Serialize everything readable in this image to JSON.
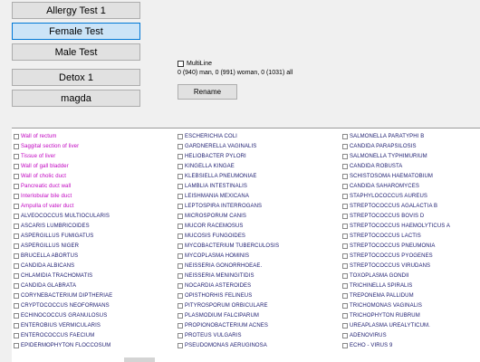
{
  "buttons": [
    "Allergy Test 1",
    "Female Test",
    "Male Test",
    "Detox 1",
    "magda"
  ],
  "selected_button": "Female Test",
  "multiline_label": "MultiLine",
  "counts_text": "0 (940) man, 0 (991) woman, 0 (1031) all",
  "rename_label": "Rename",
  "columns": [
    [
      {
        "label": "Wall of rectum",
        "style": "pink"
      },
      {
        "label": "Saggital section of liver",
        "style": "pink"
      },
      {
        "label": "Tissue of liver",
        "style": "pink"
      },
      {
        "label": "Wall of gall bladder",
        "style": "pink"
      },
      {
        "label": "Wall of cholic duct",
        "style": "pink"
      },
      {
        "label": "Pancreatic duct wall",
        "style": "pink"
      },
      {
        "label": "Interlobular bile duct",
        "style": "pink"
      },
      {
        "label": "Ampulla of vater duct",
        "style": "pink"
      },
      {
        "label": "ALVEOCOCCUS MULTIOCULARIS",
        "style": "normal"
      },
      {
        "label": "ASCARIS LUMBRICOIDES",
        "style": "normal"
      },
      {
        "label": "ASPERGILLUS FUMIGATUS",
        "style": "normal"
      },
      {
        "label": "ASPERGILLUS NIGER",
        "style": "normal"
      },
      {
        "label": "BRUCELLA ABORTUS",
        "style": "normal"
      },
      {
        "label": "CANDIDA ALBICANS",
        "style": "normal"
      },
      {
        "label": "CHLAMIDIA TRACHOMATIS",
        "style": "normal"
      },
      {
        "label": "CANDIDA GLABRATA",
        "style": "normal"
      },
      {
        "label": "CORYNEBACTERIUM DIPTHERIAE",
        "style": "normal"
      },
      {
        "label": "CRYPTOCOCCUS NEOFORMANS",
        "style": "normal"
      },
      {
        "label": "ECHINOCOCCUS GRANULOSUS",
        "style": "normal"
      },
      {
        "label": "ENTEROBIUS VERMICULARIS",
        "style": "normal"
      },
      {
        "label": "ENTEROCOCCUS FAECIUM",
        "style": "normal"
      },
      {
        "label": "EPIDERMOPHYTON FLOCCOSUM",
        "style": "normal"
      }
    ],
    [
      {
        "label": "ESCHERICHIA COLI",
        "style": "normal"
      },
      {
        "label": "GARDNERELLA VAGINALIS",
        "style": "normal"
      },
      {
        "label": "HELIOBACTER PYLORI",
        "style": "normal"
      },
      {
        "label": "KINGELLA KINGAE",
        "style": "normal"
      },
      {
        "label": "KLEBSIELLA PNEUMONIAE",
        "style": "normal"
      },
      {
        "label": "LAMBLIA INTESTINALIS",
        "style": "normal"
      },
      {
        "label": "LEISHMANIA MEXICANA",
        "style": "normal"
      },
      {
        "label": "LEPTOSPIRA INTERROGANS",
        "style": "normal"
      },
      {
        "label": "MICROSPORUM CANIS",
        "style": "normal"
      },
      {
        "label": "MUCOR RACEMOSUS",
        "style": "normal"
      },
      {
        "label": "MUCOSIS FUNGOIDES",
        "style": "normal"
      },
      {
        "label": "MYCOBACTERIUM TUBERCULOSIS",
        "style": "normal"
      },
      {
        "label": "MYCOPLASMA HOMINIS",
        "style": "normal"
      },
      {
        "label": "NEISSERIA GONORRHOEAE.",
        "style": "normal"
      },
      {
        "label": "NEISSERIA MENINGITIDIS",
        "style": "normal"
      },
      {
        "label": "NOCARDIA ASTEROIDES",
        "style": "normal"
      },
      {
        "label": "OPISTHORHIS FELINEUS",
        "style": "normal"
      },
      {
        "label": "PITYROSPORUM ORBICULARE",
        "style": "normal"
      },
      {
        "label": "PLASMODIUM FALCIPARUM",
        "style": "normal"
      },
      {
        "label": "PROPIONOBACTERIUM ACNES",
        "style": "normal"
      },
      {
        "label": "PROTEUS VULGARIS",
        "style": "normal"
      },
      {
        "label": "PSEUDOMONAS AERUGINOSA",
        "style": "normal"
      }
    ],
    [
      {
        "label": "SALMONELLA PARATYPHI B",
        "style": "normal"
      },
      {
        "label": "CANDIDA PARAPSILOSIS",
        "style": "normal"
      },
      {
        "label": "SALMONELLA TYPHIMURIUM",
        "style": "normal"
      },
      {
        "label": "CANDIDA ROBUSTA",
        "style": "normal"
      },
      {
        "label": "SCHISTOSOMA HAEMATOBIUM",
        "style": "normal"
      },
      {
        "label": "CANDIDA SAHAROMYCES",
        "style": "normal"
      },
      {
        "label": "STAPHYLOCOCCUS AUREUS",
        "style": "normal"
      },
      {
        "label": "STREPTOCOCCUS AGALACTIA B",
        "style": "normal"
      },
      {
        "label": "STREPTOCOCCUS BOVIS D",
        "style": "normal"
      },
      {
        "label": "STREPTOCOCCUS HAEMOLYTICUS A",
        "style": "normal"
      },
      {
        "label": "STREPTOCOCCUS LACTIS",
        "style": "normal"
      },
      {
        "label": "STREPTOCOCCUS PNEUMONIA",
        "style": "normal"
      },
      {
        "label": "STREPTOCOCCUS PYOGENES",
        "style": "normal"
      },
      {
        "label": "STREPTOCOCCUS VIRUDANS",
        "style": "normal"
      },
      {
        "label": "TOXOPLASMA GONDII",
        "style": "normal"
      },
      {
        "label": "TRICHINELLA SPIRALIS",
        "style": "normal"
      },
      {
        "label": "TREPONEMA PALLIDUM",
        "style": "normal"
      },
      {
        "label": "TRICHOMONAS VAGINALIS",
        "style": "normal"
      },
      {
        "label": "TRICHOPHYTON RUBRUM",
        "style": "normal"
      },
      {
        "label": "UREAPLASMA UREALYTICUM.",
        "style": "normal"
      },
      {
        "label": "ADENOVIRUS",
        "style": "normal"
      },
      {
        "label": "ECHO - VIRUS 9",
        "style": "normal"
      }
    ]
  ]
}
